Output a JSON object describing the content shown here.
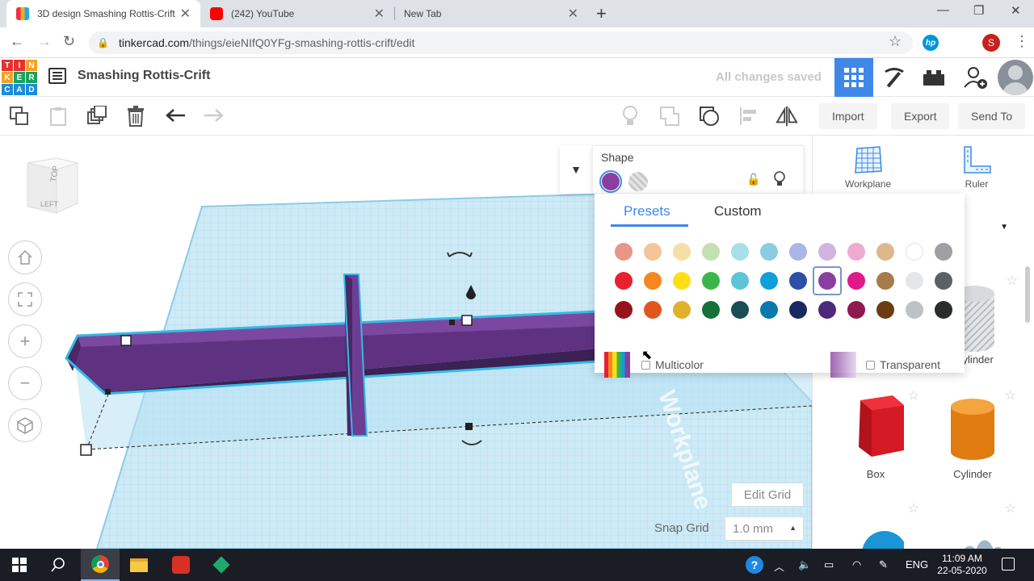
{
  "browser": {
    "tabs": [
      {
        "title": "3D design Smashing Rottis-Crift",
        "active": true
      },
      {
        "title": "(242) YouTube",
        "active": false
      },
      {
        "title": "New Tab",
        "active": false
      }
    ],
    "url_host": "tinkercad.com",
    "url_path": "/things/eieNIfQ0YFg-smashing-rottis-crift/edit",
    "profile_initial": "S",
    "hp_label": "hp"
  },
  "header": {
    "logo_letters": [
      "T",
      "I",
      "N",
      "K",
      "E",
      "R",
      "C",
      "A",
      "D"
    ],
    "design_title": "Smashing Rottis-Crift",
    "save_status": "All changes saved"
  },
  "toolbar": {
    "import_label": "Import",
    "export_label": "Export",
    "send_label": "Send To"
  },
  "viewcube": {
    "top_label": "TOP",
    "left_label": "LEFT"
  },
  "workspace": {
    "watermark": "Workplane",
    "edit_grid_label": "Edit Grid",
    "snap_grid_label": "Snap Grid",
    "snap_grid_value": "1.0 mm"
  },
  "inspector": {
    "title": "Shape",
    "tabs": {
      "presets": "Presets",
      "custom": "Custom"
    },
    "multicolor_label": "Multicolor",
    "transparent_label": "Transparent",
    "swatches": [
      [
        "#e8958a",
        "#f5c49a",
        "#f5dfa5",
        "#c5e0b0",
        "#a6dfe8",
        "#8acde3",
        "#a9b6e6",
        "#d1b4e0",
        "#eeaad0",
        "#dcb98c",
        "#ffffff",
        "#9ea0a3"
      ],
      [
        "#e8212e",
        "#f58722",
        "#ffde17",
        "#3bb54a",
        "#5bc4d6",
        "#0ea0d8",
        "#2e4fa8",
        "#8a3fa0",
        "#e0188a",
        "#a77c4a",
        "#e4e6e8",
        "#5c6166"
      ],
      [
        "#95141b",
        "#e0571e",
        "#e0b22a",
        "#157138",
        "#1a4e56",
        "#0a77ad",
        "#1a2a60",
        "#4e2a7a",
        "#8e1a4e",
        "#6a3e12",
        "#bfc2c5",
        "#2a2c2e"
      ]
    ],
    "selected_swatch": "#8a3fa0"
  },
  "right_panel": {
    "workplane_label": "Workplane",
    "ruler_label": "Ruler",
    "shapes": [
      {
        "label": "Cylinder"
      },
      {
        "label": "Box"
      },
      {
        "label": "Cylinder"
      }
    ]
  },
  "taskbar": {
    "language": "ENG",
    "time": "11:09 AM",
    "date": "22-05-2020"
  },
  "colors": {
    "accent": "#3f88e8",
    "object_purple": "#6a3a8c",
    "grid_blue": "#bfe2f2"
  }
}
